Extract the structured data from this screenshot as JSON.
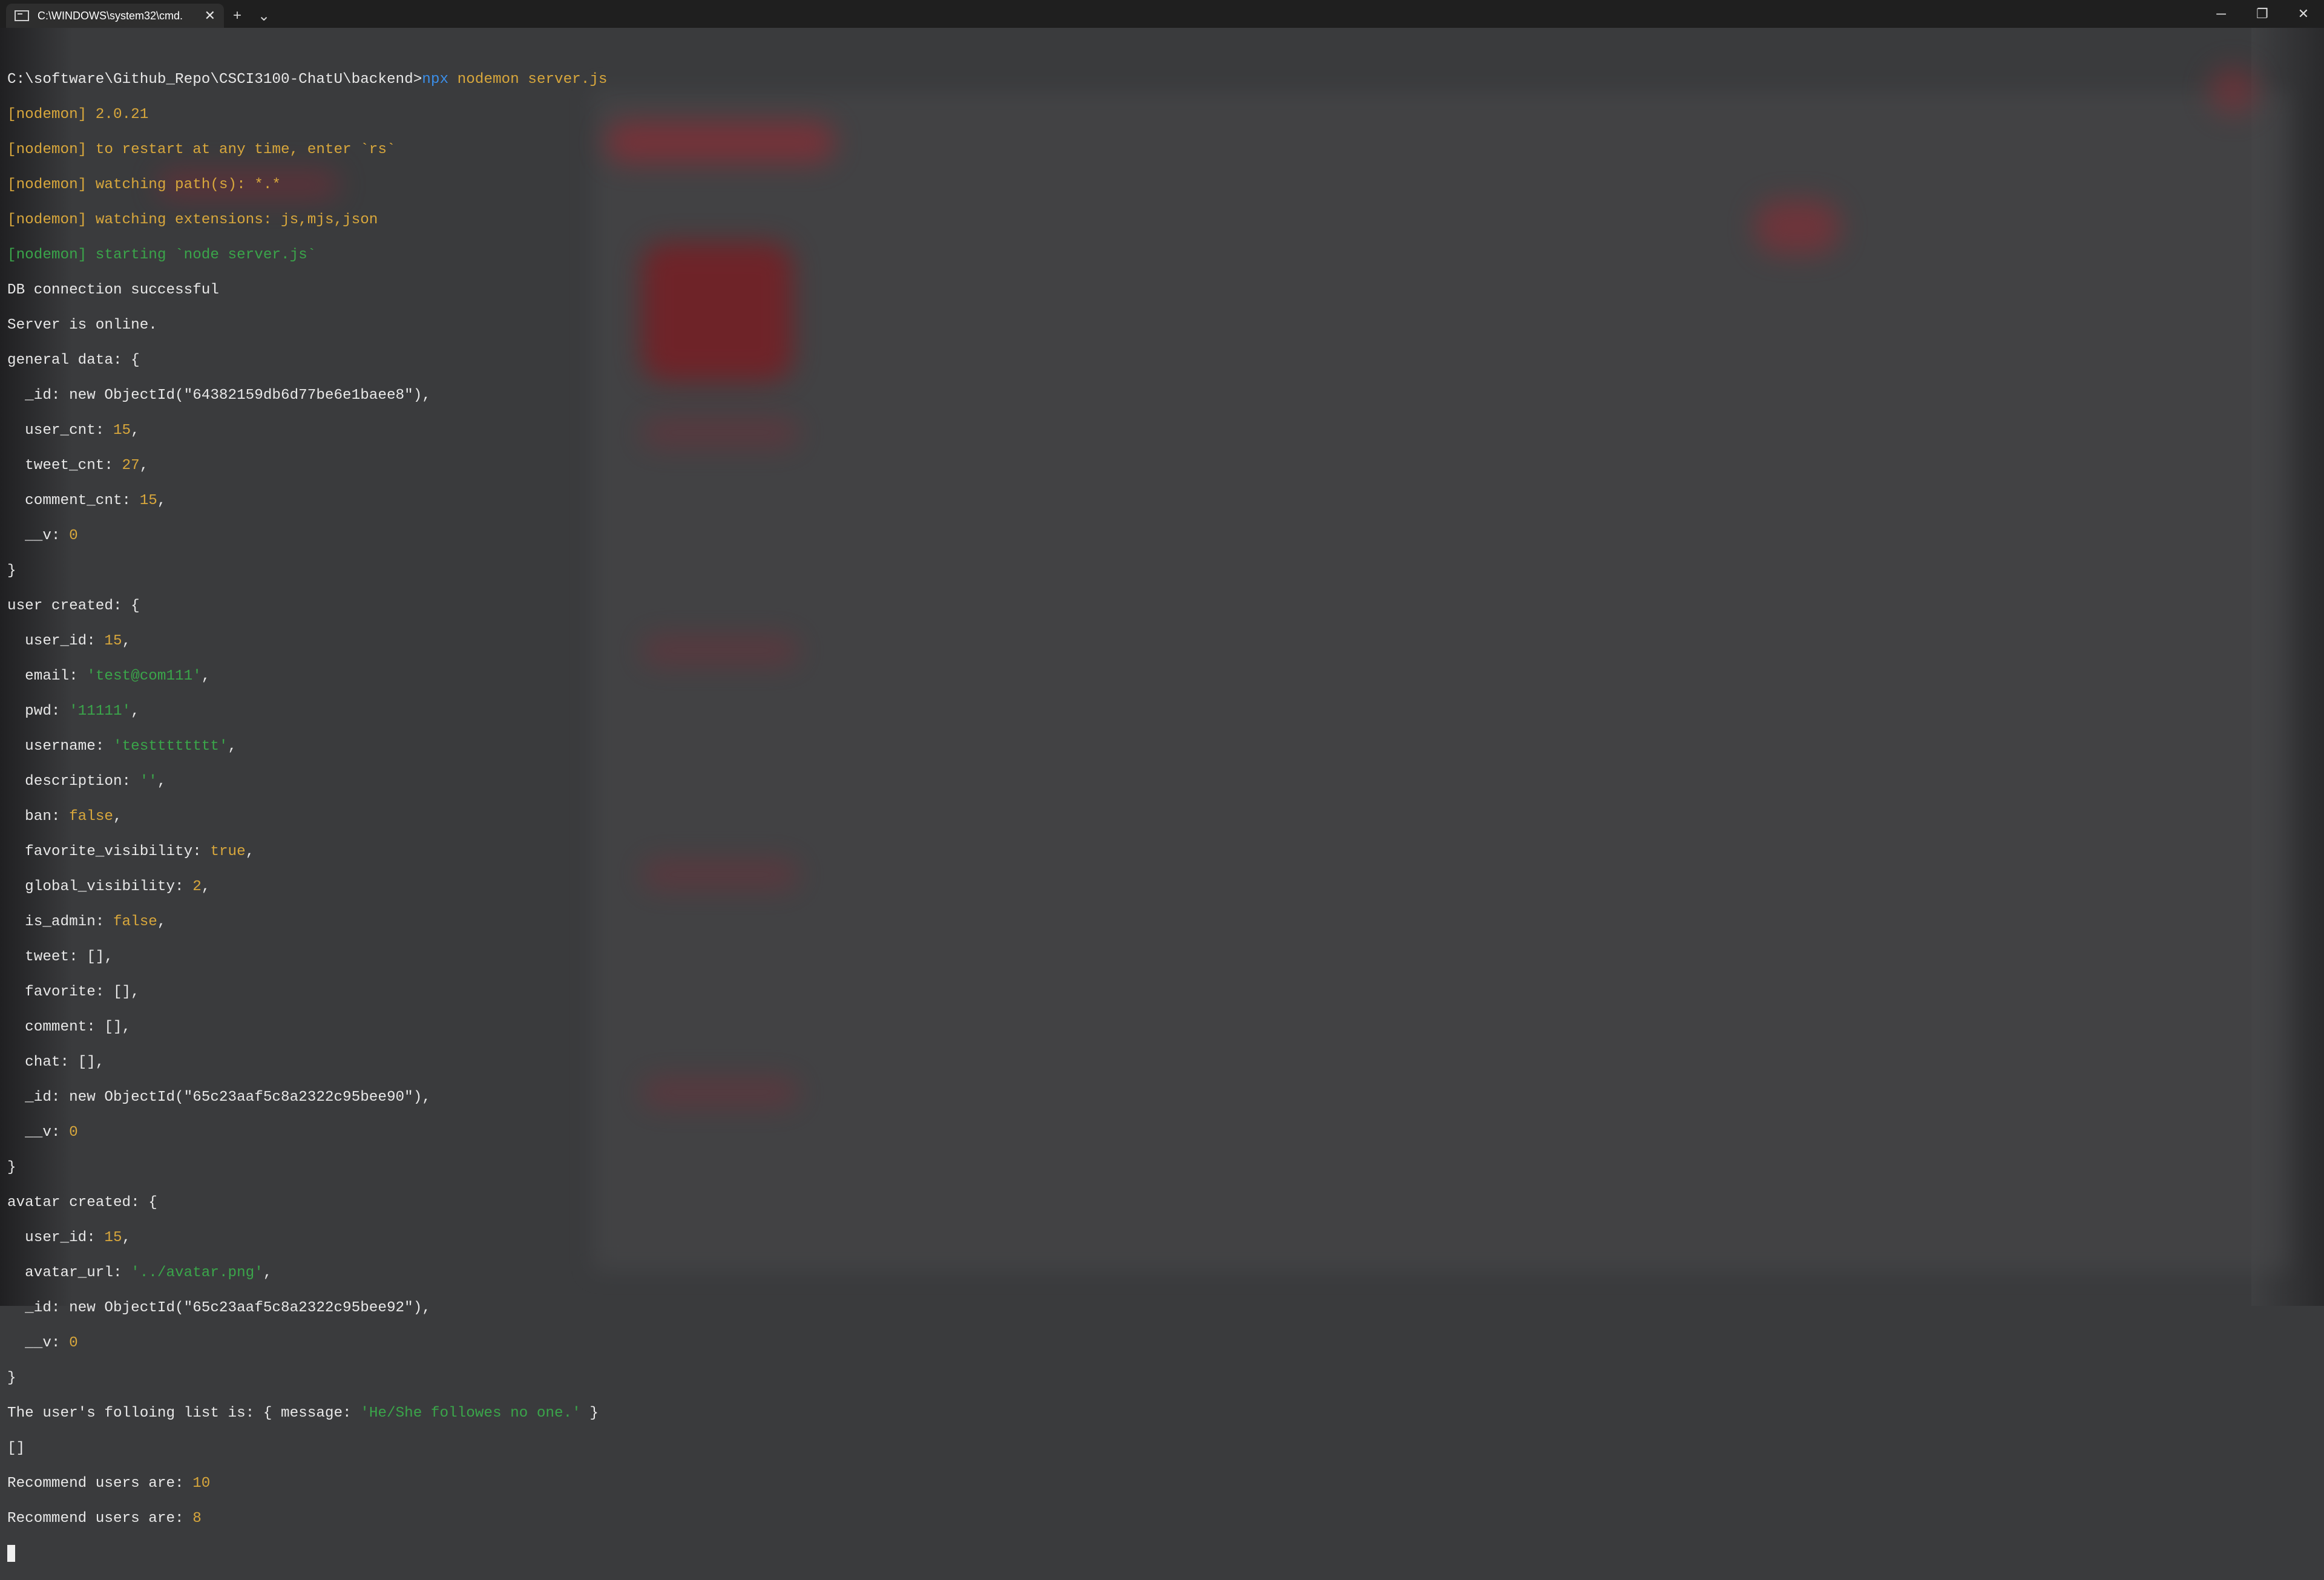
{
  "titlebar": {
    "tab_title": "C:\\WINDOWS\\system32\\cmd.",
    "tab_icon": "terminal-icon",
    "new_tab_glyph": "+",
    "dropdown_glyph": "⌄",
    "close_glyph": "✕",
    "minimize_glyph": "─",
    "restore_glyph": "❐",
    "window_close_glyph": "✕"
  },
  "terminal": {
    "prompt": "C:\\software\\Github_Repo\\CSCI3100-ChatU\\backend>",
    "cmd_npx": "npx",
    "cmd_rest": " nodemon server.js",
    "nm_version": "[nodemon] 2.0.21",
    "nm_restart": "[nodemon] to restart at any time, enter `rs`",
    "nm_watch_paths": "[nodemon] watching path(s): *.*",
    "nm_watch_ext": "[nodemon] watching extensions: js,mjs,json",
    "nm_starting": "[nodemon] starting `node server.js`",
    "db_ok": "DB connection successful",
    "server_online": "Server is online.",
    "general_open": "general data: {",
    "general_id": "  _id: new ObjectId(\"64382159db6d77be6e1baee8\"),",
    "general_user_cnt_k": "  user_cnt: ",
    "general_user_cnt_v": "15",
    "general_tweet_cnt_k": "  tweet_cnt: ",
    "general_tweet_cnt_v": "27",
    "general_comment_cnt_k": "  comment_cnt: ",
    "general_comment_cnt_v": "15",
    "general_v_k": "  __v: ",
    "general_v_v": "0",
    "close_brace": "}",
    "user_open": "user created: {",
    "user_id_k": "  user_id: ",
    "user_id_v": "15",
    "email_k": "  email: ",
    "email_v": "'test@com111'",
    "pwd_k": "  pwd: ",
    "pwd_v": "'11111'",
    "username_k": "  username: ",
    "username_v": "'testttttttt'",
    "description_k": "  description: ",
    "description_v": "''",
    "ban_k": "  ban: ",
    "ban_v": "false",
    "fav_vis_k": "  favorite_visibility: ",
    "fav_vis_v": "true",
    "glob_vis_k": "  global_visibility: ",
    "glob_vis_v": "2",
    "is_admin_k": "  is_admin: ",
    "is_admin_v": "false",
    "tweet_line": "  tweet: [],",
    "favorite_line": "  favorite: [],",
    "comment_line": "  comment: [],",
    "chat_line": "  chat: [],",
    "user_objid": "  _id: new ObjectId(\"65c23aaf5c8a2322c95bee90\"),",
    "user_v_k": "  __v: ",
    "user_v_v": "0",
    "avatar_open": "avatar created: {",
    "av_user_id_k": "  user_id: ",
    "av_user_id_v": "15",
    "av_url_k": "  avatar_url: ",
    "av_url_v": "'../avatar.png'",
    "av_objid": "  _id: new ObjectId(\"65c23aaf5c8a2322c95bee92\"),",
    "av_v_k": "  __v: ",
    "av_v_v": "0",
    "follow_pre": "The user's folloing list is: { message: ",
    "follow_msg": "'He/She followes no one.'",
    "follow_post": " }",
    "empty_arr": "[]",
    "rec_label_1": "Recommend users are: ",
    "rec_val_1": "10",
    "rec_label_2": "Recommend users are: ",
    "rec_val_2": "8"
  }
}
